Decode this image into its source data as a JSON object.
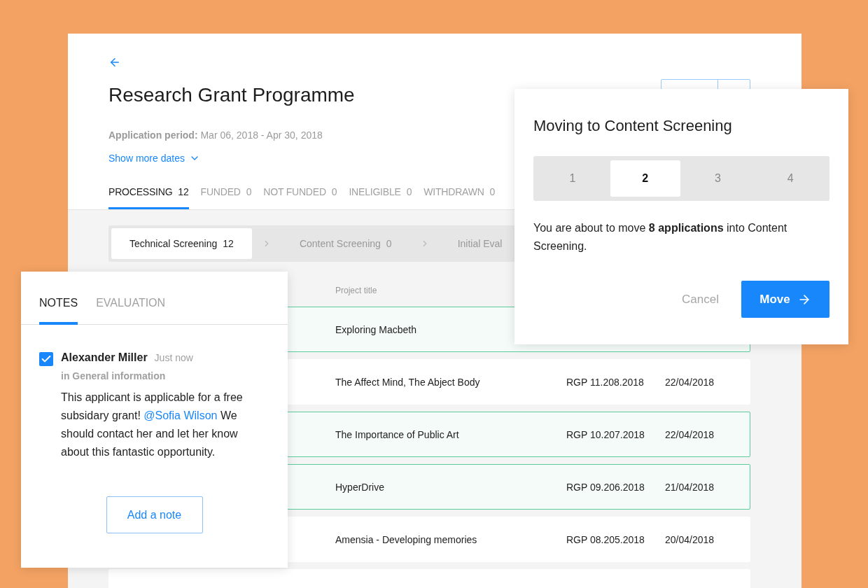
{
  "page": {
    "title": "Research Grant Programme",
    "period_label": "Application period:",
    "period": "Mar 06, 2018 - Apr 30, 2018",
    "more_dates": "Show more dates"
  },
  "tabs": [
    {
      "label": "PROCESSING",
      "count": "12",
      "selected": true
    },
    {
      "label": "FUNDED",
      "count": "0",
      "selected": false
    },
    {
      "label": "NOT FUNDED",
      "count": "0",
      "selected": false
    },
    {
      "label": "INELIGIBLE",
      "count": "0",
      "selected": false
    },
    {
      "label": "WITHDRAWN",
      "count": "0",
      "selected": false
    }
  ],
  "stages": [
    {
      "label": "Technical Screening",
      "count": "12",
      "selected": true
    },
    {
      "label": "Content Screening",
      "count": "0",
      "selected": false
    },
    {
      "label": "Initial Eval",
      "selected": false
    }
  ],
  "table": {
    "columns": [
      "Project title"
    ],
    "rows": [
      {
        "title": "Exploring Macbeth",
        "selected": true
      },
      {
        "title": "The Affect Mind, The Abject Body",
        "code": "RGP 11.208.2018",
        "date": "22/04/2018",
        "selected": false
      },
      {
        "title": "The Importance of Public Art",
        "code": "RGP 10.207.2018",
        "date": "22/04/2018",
        "selected": true
      },
      {
        "title": "HyperDrive",
        "code": "RGP 09.206.2018",
        "date": "21/04/2018",
        "selected": true
      },
      {
        "title": "Amensia - Developing memories",
        "code": "RGP 08.205.2018",
        "date": "20/04/2018",
        "selected": false
      }
    ]
  },
  "notes": {
    "tabs": [
      {
        "label": "NOTES",
        "selected": true
      },
      {
        "label": "EVALUATION",
        "selected": false
      }
    ],
    "note": {
      "checked": true,
      "author": "Alexander Miller",
      "time": "Just now",
      "context": "in General information",
      "text_before": "This applicant is applicable for a free subsidary grant! ",
      "mention": "@Sofia Wilson",
      "text_after": " We should contact her and let her know about this fantastic opportunity."
    },
    "add_button": "Add a note"
  },
  "dialog": {
    "title": "Moving to Content Screening",
    "steps": [
      {
        "label": "1",
        "selected": false
      },
      {
        "label": "2",
        "selected": true
      },
      {
        "label": "3",
        "selected": false
      },
      {
        "label": "4",
        "selected": false
      }
    ],
    "message": "You are about to move **8 applications** into Content Screening.",
    "cancel": "Cancel",
    "confirm": "Move"
  }
}
